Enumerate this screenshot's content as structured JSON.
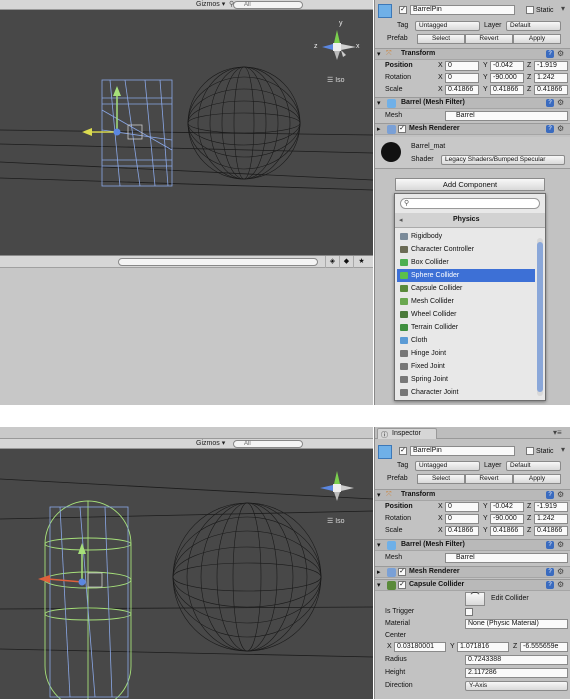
{
  "top": {
    "scene": {
      "gizmos_label": "Gizmos",
      "gizmos_arrow": "▾",
      "search_placeholder": "All",
      "view_label": "Iso",
      "axis_y": "y",
      "axis_z": "z",
      "axis_x": "x"
    },
    "inspector": {
      "object_name": "BarrelPin",
      "static_label": "Static",
      "tag_label": "Tag",
      "tag_value": "Untagged",
      "layer_label": "Layer",
      "layer_value": "Default",
      "prefab_label": "Prefab",
      "prefab_buttons": [
        "Select",
        "Revert",
        "Apply"
      ],
      "transform": {
        "title": "Transform",
        "rows": [
          {
            "label": "Position",
            "x": "0",
            "y": "-0.042",
            "z": "-1.919"
          },
          {
            "label": "Rotation",
            "x": "0",
            "y": "-90.000",
            "z": "1.242"
          },
          {
            "label": "Scale",
            "x": "0.41866",
            "y": "0.41866",
            "z": "0.41866"
          }
        ]
      },
      "mesh_filter": {
        "title": "Barrel (Mesh Filter)",
        "mesh_label": "Mesh",
        "mesh_value": "Barrel"
      },
      "mesh_renderer": {
        "title": "Mesh Renderer"
      },
      "material": {
        "name": "Barrel_mat",
        "shader_label": "Shader",
        "shader_value": "Legacy Shaders/Bumped Specular"
      },
      "add_component": "Add Component",
      "popup": {
        "category": "Physics",
        "back_arrow": "◂",
        "items": [
          {
            "label": "Rigidbody",
            "icon_color": "#7a8a99"
          },
          {
            "label": "Character Controller",
            "icon_color": "#6b6b55"
          },
          {
            "label": "Box Collider",
            "icon_color": "#4caf50"
          },
          {
            "label": "Sphere Collider",
            "icon_color": "#5cbf4a",
            "selected": true
          },
          {
            "label": "Capsule Collider",
            "icon_color": "#5a8a3a"
          },
          {
            "label": "Mesh Collider",
            "icon_color": "#6aa84f"
          },
          {
            "label": "Wheel Collider",
            "icon_color": "#4a7a3a"
          },
          {
            "label": "Terrain Collider",
            "icon_color": "#3f8f3f"
          },
          {
            "label": "Cloth",
            "icon_color": "#5b9bd5"
          },
          {
            "label": "Hinge Joint",
            "icon_color": "#777777"
          },
          {
            "label": "Fixed Joint",
            "icon_color": "#777777"
          },
          {
            "label": "Spring Joint",
            "icon_color": "#777777"
          },
          {
            "label": "Character Joint",
            "icon_color": "#777777"
          }
        ]
      }
    }
  },
  "bottom": {
    "tab": "Inspector",
    "scene": {
      "gizmos_label": "Gizmos",
      "gizmos_arrow": "▾",
      "search_placeholder": "All",
      "view_label": "Iso"
    },
    "inspector": {
      "object_name": "BarrelPin",
      "static_label": "Static",
      "tag_label": "Tag",
      "tag_value": "Untagged",
      "layer_label": "Layer",
      "layer_value": "Default",
      "prefab_label": "Prefab",
      "prefab_buttons": [
        "Select",
        "Revert",
        "Apply"
      ],
      "transform": {
        "title": "Transform",
        "rows": [
          {
            "label": "Position",
            "x": "0",
            "y": "-0.042",
            "z": "-1.919"
          },
          {
            "label": "Rotation",
            "x": "0",
            "y": "-90.000",
            "z": "1.242"
          },
          {
            "label": "Scale",
            "x": "0.41866",
            "y": "0.41866",
            "z": "0.41866"
          }
        ]
      },
      "mesh_filter": {
        "title": "Barrel (Mesh Filter)",
        "mesh_label": "Mesh",
        "mesh_value": "Barrel"
      },
      "mesh_renderer": {
        "title": "Mesh Renderer"
      },
      "capsule": {
        "title": "Capsule Collider",
        "edit_label": "Edit Collider",
        "is_trigger_label": "Is Trigger",
        "material_label": "Material",
        "material_value": "None (Physic Material)",
        "center_label": "Center",
        "center_x": "0.03180001",
        "center_y": "1.071816",
        "center_z": "-6.555659e",
        "radius_label": "Radius",
        "radius_value": "0.7243388",
        "height_label": "Height",
        "height_value": "2.117286",
        "direction_label": "Direction",
        "direction_value": "Y-Axis"
      }
    }
  },
  "colors": {
    "scene_bg": "#484848",
    "inspector_bg": "#c2c2c2",
    "selection": "#3d70d6",
    "wire_blue": "#8aa7e6",
    "wire_green": "#a6e07a"
  }
}
